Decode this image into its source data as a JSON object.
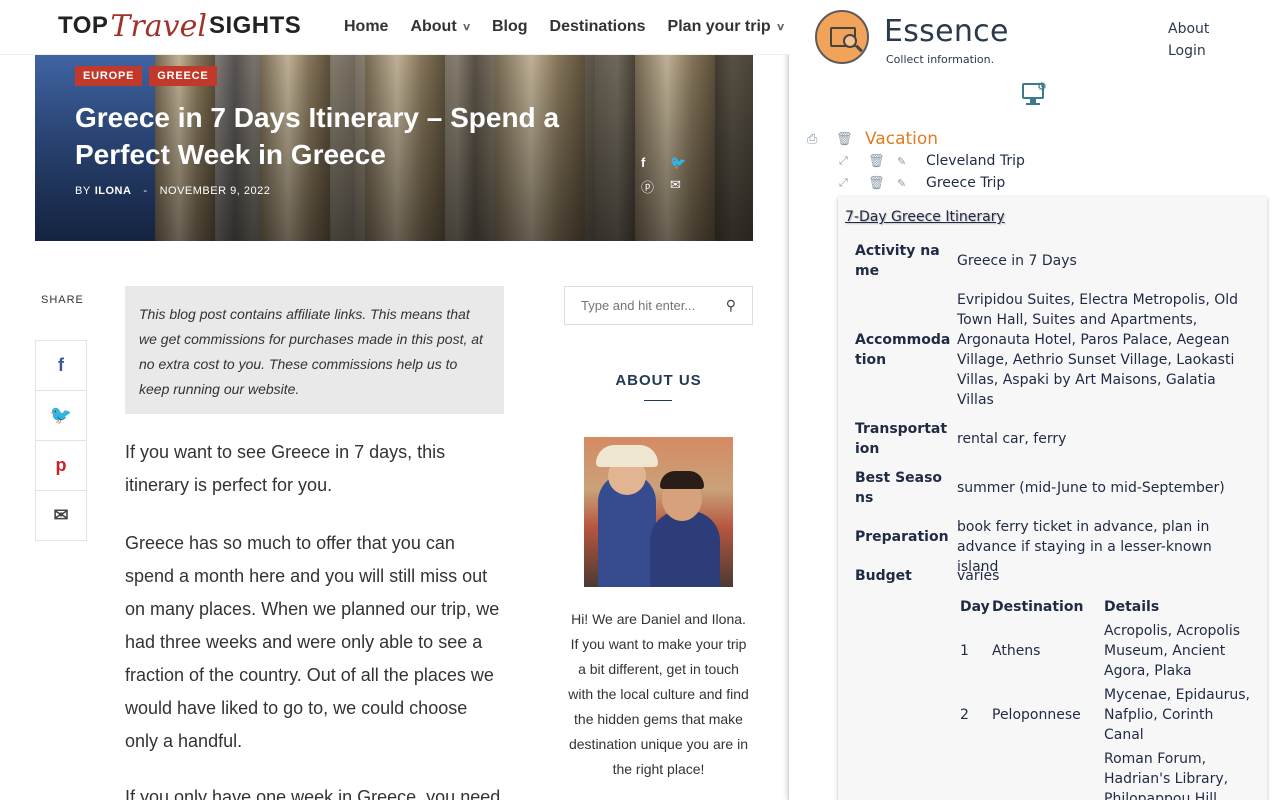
{
  "blog": {
    "logo": {
      "part1": "TOP",
      "part2": "Travel",
      "part3": "SIGHTS"
    },
    "nav": [
      {
        "label": "Home",
        "dropdown": false
      },
      {
        "label": "About",
        "dropdown": true
      },
      {
        "label": "Blog",
        "dropdown": false
      },
      {
        "label": "Destinations",
        "dropdown": false
      },
      {
        "label": "Plan your trip",
        "dropdown": true
      }
    ],
    "hero": {
      "tags": [
        "EUROPE",
        "GREECE"
      ],
      "title": "Greece in 7 Days Itinerary – Spend a Perfect Week in Greece",
      "by": "BY",
      "author": "ILONA",
      "separator": "-",
      "date": "NOVEMBER 9, 2022",
      "share_icons": [
        "facebook-icon",
        "twitter-icon",
        "pinterest-icon",
        "mail-icon"
      ]
    },
    "share": {
      "label": "SHARE",
      "buttons": [
        {
          "icon": "facebook-icon",
          "glyph": "f"
        },
        {
          "icon": "twitter-icon",
          "glyph": "🐦"
        },
        {
          "icon": "pinterest-icon",
          "glyph": "p"
        },
        {
          "icon": "mail-icon",
          "glyph": "✉"
        }
      ]
    },
    "disclaimer": "This blog post contains affiliate links. This means that we get commissions for purchases made in this post, at no extra cost to you. These commissions help us to keep running our website.",
    "paragraphs": [
      "If you want to see Greece in 7 days, this itinerary is perfect for you.",
      "Greece has so much to offer that you can spend a month here and you will still miss out on many places. When we planned our trip, we had three weeks and were only able to see a fraction of the country. Out of all the places we would have liked to go to, we could choose only a handful.",
      "If you only have one week in Greece, you need"
    ],
    "sidebar": {
      "search_placeholder": "Type and hit enter...",
      "about_title": "ABOUT US",
      "about_text": "Hi! We are Daniel and Ilona. If you want to make your trip a bit different, get in touch with the local culture and find the hidden gems that make destination unique you are in the right place!"
    }
  },
  "essence": {
    "name": "Essence",
    "tagline": "Collect information.",
    "links": [
      "About",
      "Login"
    ],
    "tree": {
      "folder": "Vacation",
      "items": [
        "Cleveland Trip",
        "Greece Trip"
      ]
    },
    "card": {
      "title": "7-Day Greece Itinerary",
      "fields": [
        {
          "label": "Activity name",
          "value": "Greece in 7 Days"
        },
        {
          "label": "Accommodation",
          "value": "Evripidou Suites, Electra Metropolis, Old Town Hall, Suites and Apartments, Argonauta Hotel, Paros Palace, Aegean Village, Aethrio Sunset Village, Laokasti Villas, Aspaki by Art Maisons, Galatia Villas"
        },
        {
          "label": "Transportation",
          "value": "rental car, ferry"
        },
        {
          "label": "Best Seasons",
          "value": "summer (mid-June to mid-September)"
        },
        {
          "label": "Preparation",
          "value": "book ferry ticket in advance, plan in advance if staying in a lesser-known island"
        },
        {
          "label": "Budget",
          "value": "varies"
        }
      ],
      "days_table": {
        "headers": [
          "Day",
          "Destination",
          "Details"
        ],
        "rows": [
          {
            "day": "1",
            "destination": "Athens",
            "details": "Acropolis, Acropolis Museum, Ancient Agora, Plaka"
          },
          {
            "day": "2",
            "destination": "Peloponnese",
            "details": "Mycenae, Epidaurus, Nafplio, Corinth Canal"
          },
          {
            "day": "",
            "destination": "",
            "details": "Roman Forum, Hadrian's Library, Philopappou Hill"
          }
        ]
      }
    }
  },
  "colors": {
    "tag_red": "#c0392b",
    "logo_script": "#a0322a",
    "essence_accent": "#e07d22",
    "essence_text": "#1f2a44",
    "about_title": "#233a55"
  }
}
